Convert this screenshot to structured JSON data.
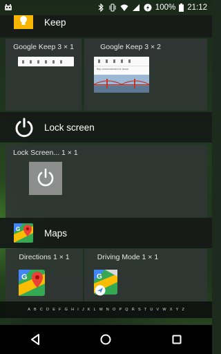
{
  "status": {
    "battery_percent": "100%",
    "time": "21:12"
  },
  "sections": {
    "keep": {
      "title": "Keep",
      "widgets": [
        {
          "label": "Google Keep  3 × 1"
        },
        {
          "label": "Google Keep  3 × 2",
          "preview_text": "Bay conservatories for fauna"
        }
      ]
    },
    "lock": {
      "title": "Lock screen",
      "widgets": [
        {
          "label": "Lock Screen...     1 × 1"
        }
      ]
    },
    "maps": {
      "title": "Maps",
      "widgets": [
        {
          "label": "Directions  1 × 1"
        },
        {
          "label": "Driving Mode  1 × 1"
        }
      ]
    }
  },
  "alphabet": [
    "A",
    "B",
    "C",
    "D",
    "E",
    "F",
    "G",
    "H",
    "I",
    "J",
    "K",
    "L",
    "M",
    "N",
    "O",
    "P",
    "Q",
    "R",
    "S",
    "T",
    "U",
    "V",
    "W",
    "X",
    "Y",
    "Z"
  ],
  "icons": {
    "keep": "keep-bulb-icon",
    "lock": "power-icon",
    "maps": "google-maps-icon"
  },
  "colors": {
    "keep_yellow": "#f7b500",
    "maps_green": "#34a853",
    "maps_red": "#ea4335",
    "maps_blue": "#4285f4"
  }
}
